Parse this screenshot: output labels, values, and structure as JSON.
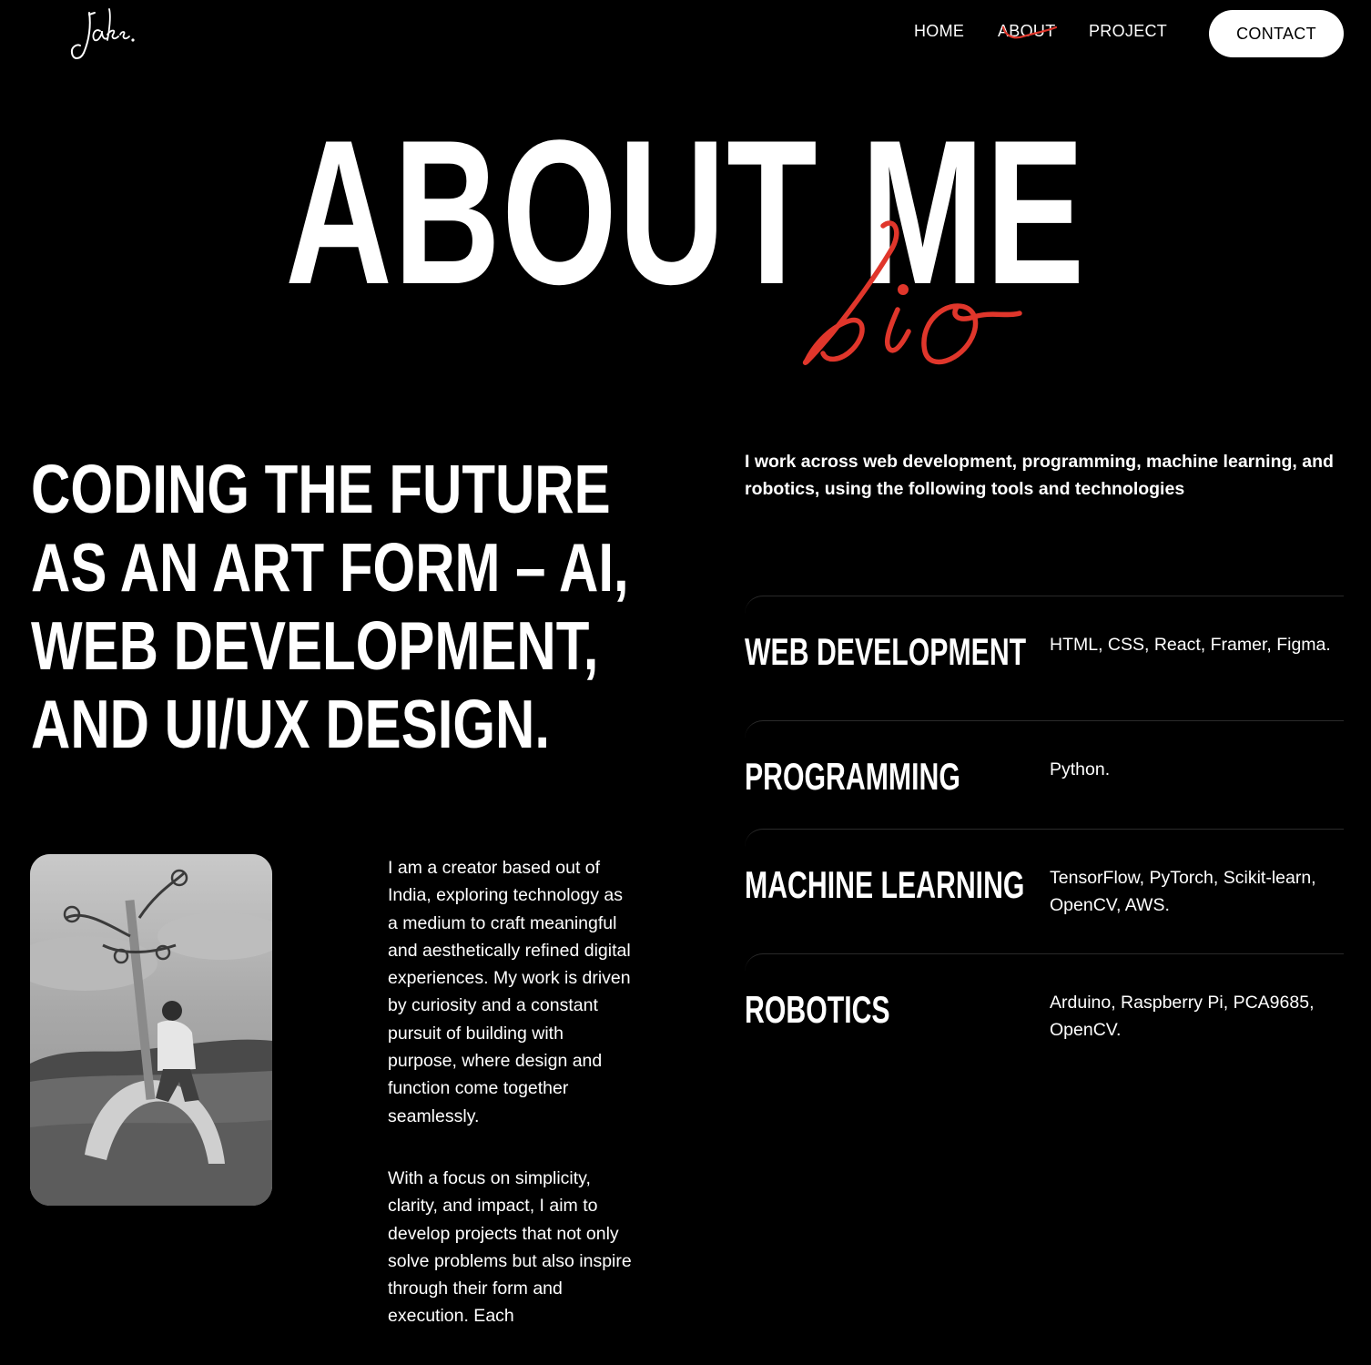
{
  "logo": {
    "text": "Jake."
  },
  "nav": {
    "items": [
      {
        "label": "HOME",
        "active": false
      },
      {
        "label": "ABOUT",
        "active": true
      },
      {
        "label": "PROJECT",
        "active": false
      }
    ],
    "contact_label": "CONTACT"
  },
  "hero": {
    "title": "ABOUT ME",
    "script": "bio"
  },
  "tagline": "CODING THE FUTURE AS AN ART FORM – AI, WEB DEVELOPMENT, AND UI/UX DESIGN.",
  "intro": "I work across web development, programming, machine learning, and robotics, using the following tools and technologies",
  "skills": [
    {
      "name": "WEB DEVELOPMENT",
      "tools": "HTML, CSS, React, Framer, Figma."
    },
    {
      "name": "PROGRAMMING",
      "tools": "Python."
    },
    {
      "name": "MACHINE LEARNING",
      "tools": "TensorFlow, PyTorch, Scikit-learn, OpenCV, AWS."
    },
    {
      "name": "ROBOTICS",
      "tools": "Arduino, Raspberry Pi, PCA9685, OpenCV."
    }
  ],
  "bio": {
    "paragraph1": "I am a creator based out of India, exploring technology as a medium to craft meaningful and aesthetically refined digital experiences. My work is driven by curiosity and a constant pursuit of building with purpose, where design and function come together seamlessly.",
    "paragraph2": "With a focus on simplicity, clarity, and impact, I aim to develop projects that not only solve problems but also inspire through their form and execution. Each"
  },
  "colors": {
    "background": "#000000",
    "text": "#ffffff",
    "accent": "#e0362b"
  }
}
